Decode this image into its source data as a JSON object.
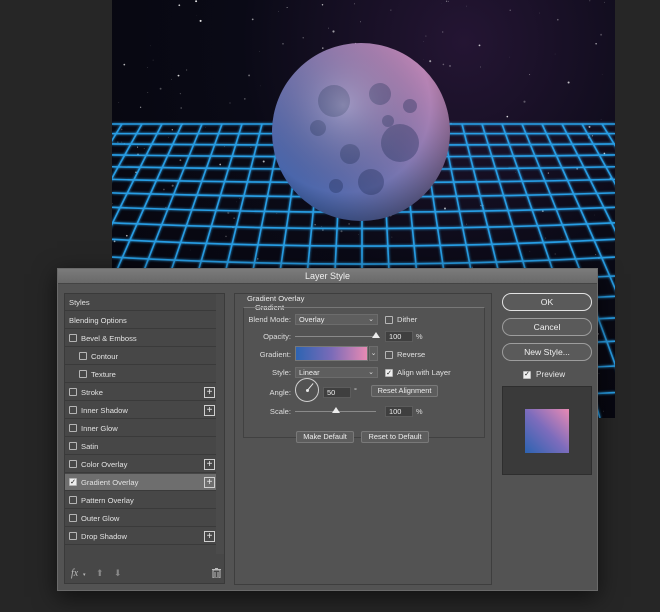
{
  "dialog": {
    "title": "Layer Style",
    "buttons": {
      "ok": "OK",
      "cancel": "Cancel",
      "new_style": "New Style..."
    },
    "preview": {
      "label": "Preview",
      "checked": true
    }
  },
  "styles_list": {
    "items": [
      {
        "label": "Styles",
        "checkbox": false,
        "checked": false,
        "plus": false,
        "indent": 0,
        "active": false
      },
      {
        "label": "Blending Options",
        "checkbox": false,
        "checked": false,
        "plus": false,
        "indent": 0,
        "active": false
      },
      {
        "label": "Bevel & Emboss",
        "checkbox": true,
        "checked": false,
        "plus": false,
        "indent": 0,
        "active": false
      },
      {
        "label": "Contour",
        "checkbox": true,
        "checked": false,
        "plus": false,
        "indent": 1,
        "active": false
      },
      {
        "label": "Texture",
        "checkbox": true,
        "checked": false,
        "plus": false,
        "indent": 1,
        "active": false
      },
      {
        "label": "Stroke",
        "checkbox": true,
        "checked": false,
        "plus": true,
        "indent": 0,
        "active": false
      },
      {
        "label": "Inner Shadow",
        "checkbox": true,
        "checked": false,
        "plus": true,
        "indent": 0,
        "active": false
      },
      {
        "label": "Inner Glow",
        "checkbox": true,
        "checked": false,
        "plus": false,
        "indent": 0,
        "active": false
      },
      {
        "label": "Satin",
        "checkbox": true,
        "checked": false,
        "plus": false,
        "indent": 0,
        "active": false
      },
      {
        "label": "Color Overlay",
        "checkbox": true,
        "checked": false,
        "plus": true,
        "indent": 0,
        "active": false
      },
      {
        "label": "Gradient Overlay",
        "checkbox": true,
        "checked": true,
        "plus": true,
        "indent": 0,
        "active": true
      },
      {
        "label": "Pattern Overlay",
        "checkbox": true,
        "checked": false,
        "plus": false,
        "indent": 0,
        "active": false
      },
      {
        "label": "Outer Glow",
        "checkbox": true,
        "checked": false,
        "plus": false,
        "indent": 0,
        "active": false
      },
      {
        "label": "Drop Shadow",
        "checkbox": true,
        "checked": false,
        "plus": true,
        "indent": 0,
        "active": false
      }
    ],
    "bottom_icons": [
      "fx-icon",
      "arrow-up-icon",
      "arrow-down-icon",
      "trash-icon"
    ]
  },
  "gradient_overlay": {
    "heading": "Gradient Overlay",
    "subheading": "Gradient",
    "blend_mode": {
      "label": "Blend Mode:",
      "value": "Overlay"
    },
    "dither": {
      "label": "Dither",
      "checked": false
    },
    "opacity": {
      "label": "Opacity:",
      "value": "100",
      "unit": "%",
      "level": 1.0
    },
    "gradient": {
      "label": "Gradient:",
      "start_color": "#2d64b2",
      "end_color": "#e78ab3"
    },
    "reverse": {
      "label": "Reverse",
      "checked": false
    },
    "style": {
      "label": "Style:",
      "value": "Linear"
    },
    "align_with_layer": {
      "label": "Align with Layer",
      "checked": true
    },
    "angle": {
      "label": "Angle:",
      "value": "50",
      "unit": "°"
    },
    "reset_alignment": "Reset Alignment",
    "scale": {
      "label": "Scale:",
      "value": "100",
      "unit": "%",
      "level": 0.5
    },
    "make_default": "Make Default",
    "reset_to_default": "Reset to Default"
  }
}
